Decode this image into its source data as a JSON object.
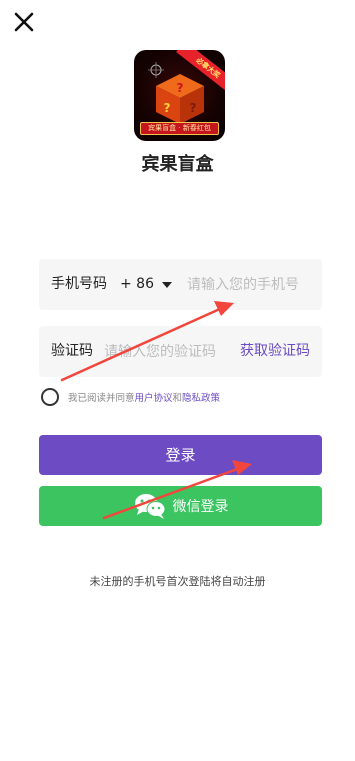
{
  "header": {
    "close_icon": "close-icon"
  },
  "app": {
    "name": "宾果盲盒",
    "logo": {
      "ribbon": "必拿大奖",
      "caption": "宾果盲盒 · 新春红包"
    }
  },
  "phone_field": {
    "label": "手机号码",
    "country_code": "+ 86",
    "placeholder": "请输入您的手机号",
    "value": ""
  },
  "code_field": {
    "label": "验证码",
    "placeholder": "请输入您的验证码",
    "value": "",
    "get_code_label": "获取验证码"
  },
  "agreement": {
    "checked": false,
    "prefix": "我已阅读并同意",
    "user_agreement": "用户协议",
    "conjunction": "和",
    "privacy_policy": "隐私政策"
  },
  "buttons": {
    "login_label": "登录",
    "wechat_label": "微信登录"
  },
  "footer": {
    "note": "未注册的手机号首次登陆将自动注册"
  },
  "colors": {
    "primary": "#6d4bc3",
    "wechat_green": "#3cc460",
    "link": "#6a4bc3",
    "annotation_arrow": "#f2463c"
  }
}
